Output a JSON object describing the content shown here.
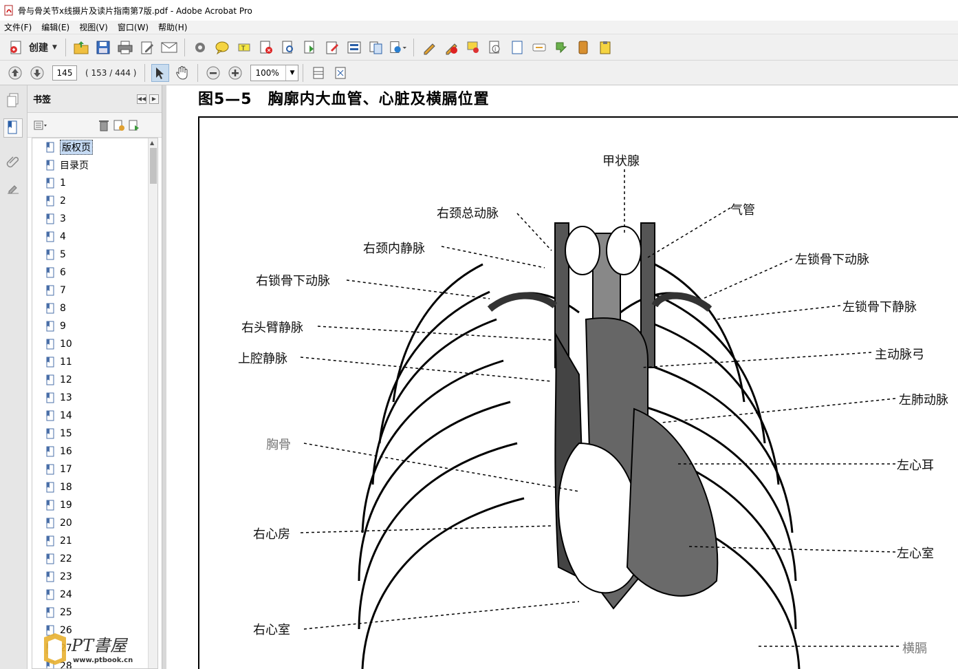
{
  "window": {
    "title": "骨与骨关节x线摄片及读片指南第7版.pdf - Adobe Acrobat Pro"
  },
  "menu": [
    "文件(F)",
    "编辑(E)",
    "视图(V)",
    "窗口(W)",
    "帮助(H)"
  ],
  "toolbar": {
    "create_label": "创建"
  },
  "nav": {
    "page_value": "145",
    "page_count": "( 153 / 444 )",
    "zoom_value": "100%"
  },
  "bookmarks": {
    "title": "书签",
    "items": [
      "版权页",
      "目录页",
      "1",
      "2",
      "3",
      "4",
      "5",
      "6",
      "7",
      "8",
      "9",
      "10",
      "11",
      "12",
      "13",
      "14",
      "15",
      "16",
      "17",
      "18",
      "19",
      "20",
      "21",
      "22",
      "23",
      "24",
      "25",
      "26",
      "27",
      "28"
    ],
    "selected_index": 0
  },
  "figure": {
    "title": "图5—5　胸廓内大血管、心脏及横膈位置",
    "labels": {
      "thyroid": "甲状腺",
      "trachea": "气管",
      "right_common_carotid": "右颈总动脉",
      "right_internal_jugular": "右颈内静脉",
      "left_subclavian_artery": "左锁骨下动脉",
      "right_subclavian_artery": "右锁骨下动脉",
      "left_subclavian_vein": "左锁骨下静脉",
      "right_brachiocephalic": "右头臂静脉",
      "aortic_arch": "主动脉弓",
      "svc": "上腔静脉",
      "left_pulmonary_artery": "左肺动脉",
      "sternum": "胸骨",
      "left_auricle": "左心耳",
      "right_atrium": "右心房",
      "left_ventricle": "左心室",
      "right_ventricle": "右心室",
      "diaphragm": "横膈"
    }
  },
  "watermark": {
    "text": "PT書屋",
    "url": "www.ptbook.cn"
  }
}
